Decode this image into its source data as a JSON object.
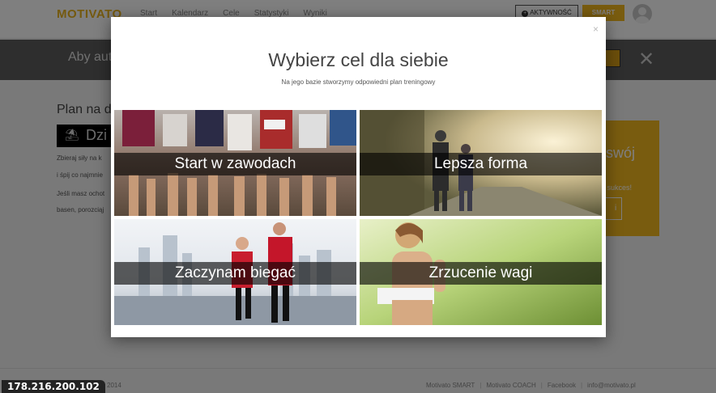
{
  "header": {
    "logo": "MOTIVATO",
    "nav": [
      "Start",
      "Kalendarz",
      "Cele",
      "Statystyki",
      "Wyniki"
    ],
    "aktywnosc_label": "AKTYWNOŚĆ",
    "smart_label": "SMART"
  },
  "banner": {
    "text": "Aby aut"
  },
  "background": {
    "plan_title": "Plan na dz",
    "dark_box_text": "Dzi",
    "para_lines": [
      "Zbieraj siły na k",
      "i śpij co najmnie",
      "Jeśli masz ochot",
      "basen, porozciąj"
    ],
    "card_word": "swój",
    "card_small": "a sukces!",
    "card_btn": "i"
  },
  "modal": {
    "close_glyph": "×",
    "title": "Wybierz cel dla siebie",
    "subtitle": "Na jego bazie stworzymy odpowiedni plan treningowy",
    "goals": [
      {
        "label": "Start w zawodach"
      },
      {
        "label": "Lepsza forma"
      },
      {
        "label": "Zaczynam biegać"
      },
      {
        "label": "Zrzucenie wagi"
      }
    ]
  },
  "footer": {
    "year": "2014",
    "links": [
      "Motivato SMART",
      "Motivato COACH",
      "Facebook",
      "info@motivato.pl"
    ]
  },
  "ip_badge": "178.216.200.102",
  "colors": {
    "brand_yellow": "#f3b81f",
    "banner_gray": "#5c5c5c"
  }
}
